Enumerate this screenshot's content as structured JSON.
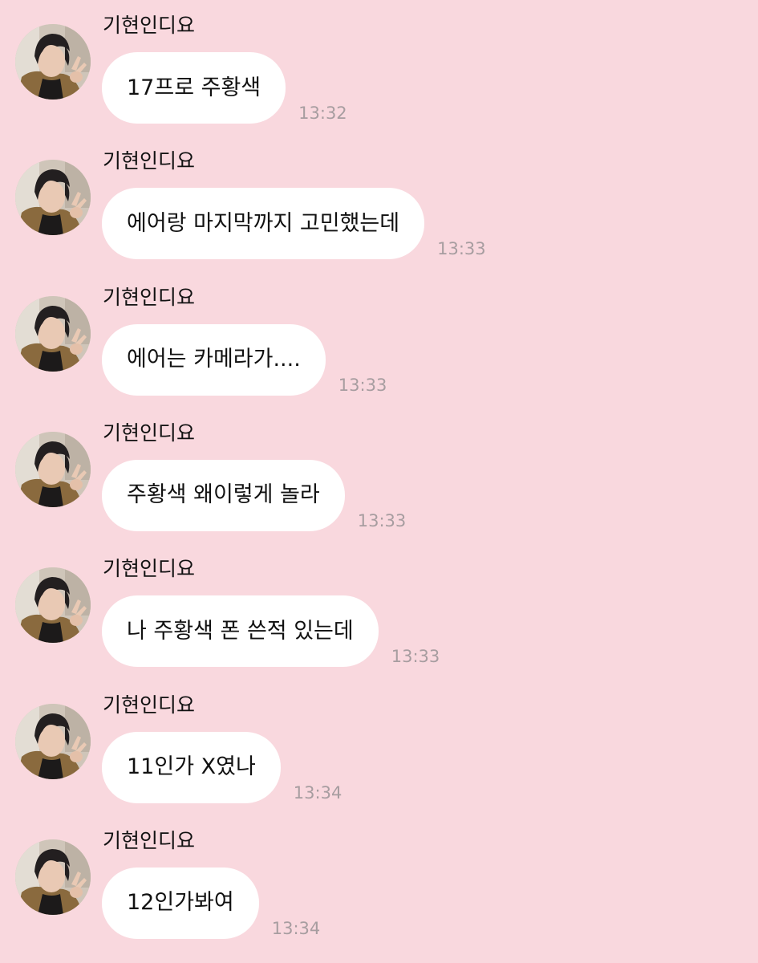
{
  "theme": {
    "background": "#f9d8de",
    "bubble": "#ffffff",
    "timestamp_color": "#a79da0"
  },
  "messages": [
    {
      "sender": "기현인디요",
      "text": "17프로 주황색",
      "time": "13:32",
      "avatar_icon": "profile-photo"
    },
    {
      "sender": "기현인디요",
      "text": "에어랑 마지막까지 고민했는데",
      "time": "13:33",
      "avatar_icon": "profile-photo"
    },
    {
      "sender": "기현인디요",
      "text": "에어는 카메라가....",
      "time": "13:33",
      "avatar_icon": "profile-photo"
    },
    {
      "sender": "기현인디요",
      "text": "주황색 왜이렇게 놀라",
      "time": "13:33",
      "avatar_icon": "profile-photo"
    },
    {
      "sender": "기현인디요",
      "text": "나 주황색 폰 쓴적 있는데",
      "time": "13:33",
      "avatar_icon": "profile-photo"
    },
    {
      "sender": "기현인디요",
      "text": "11인가 X였나",
      "time": "13:34",
      "avatar_icon": "profile-photo"
    },
    {
      "sender": "기현인디요",
      "text": "12인가봐여",
      "time": "13:34",
      "avatar_icon": "profile-photo"
    }
  ]
}
